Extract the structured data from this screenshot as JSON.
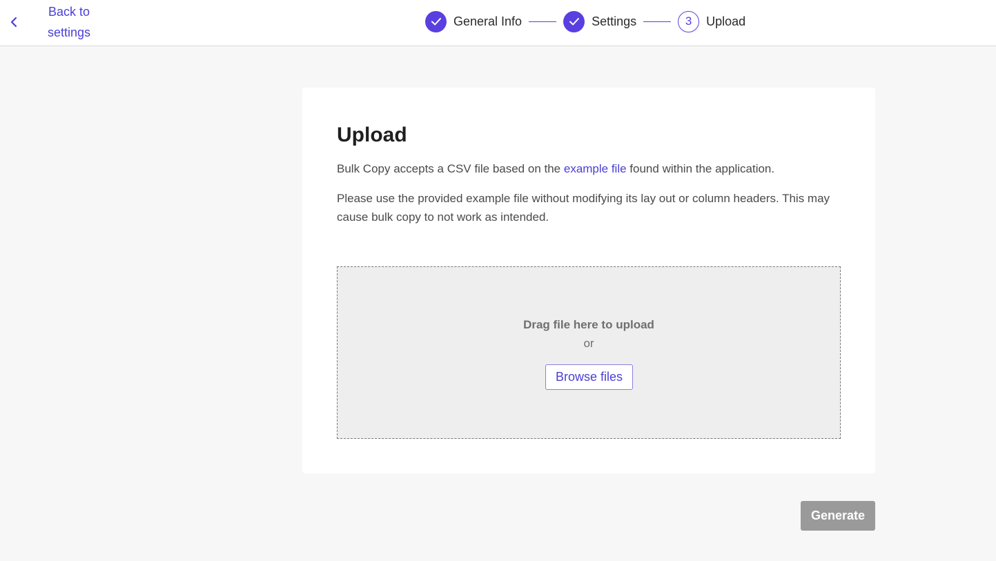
{
  "header": {
    "back_label": "Back to settings",
    "back_icon": "chevron-left-icon",
    "steps": [
      {
        "label": "General Info",
        "state": "done",
        "icon": "check-icon"
      },
      {
        "label": "Settings",
        "state": "done",
        "icon": "check-icon"
      },
      {
        "label": "Upload",
        "state": "current",
        "number": "3"
      }
    ]
  },
  "card": {
    "title": "Upload",
    "description_before_link": "Bulk Copy accepts a CSV file based on the ",
    "description_link": "example file",
    "description_after_link": " found within the application.",
    "note": "Please use the provided example file without modifying its lay out or column headers. This may cause bulk copy to not work as intended."
  },
  "dropzone": {
    "title": "Drag file here to upload",
    "or_text": "or",
    "browse_label": "Browse files"
  },
  "actions": {
    "generate_label": "Generate",
    "generate_enabled": false
  },
  "colors": {
    "accent": "#5a3fe0",
    "link": "#4b3fd6",
    "disabled_button": "#9a9a9a"
  }
}
